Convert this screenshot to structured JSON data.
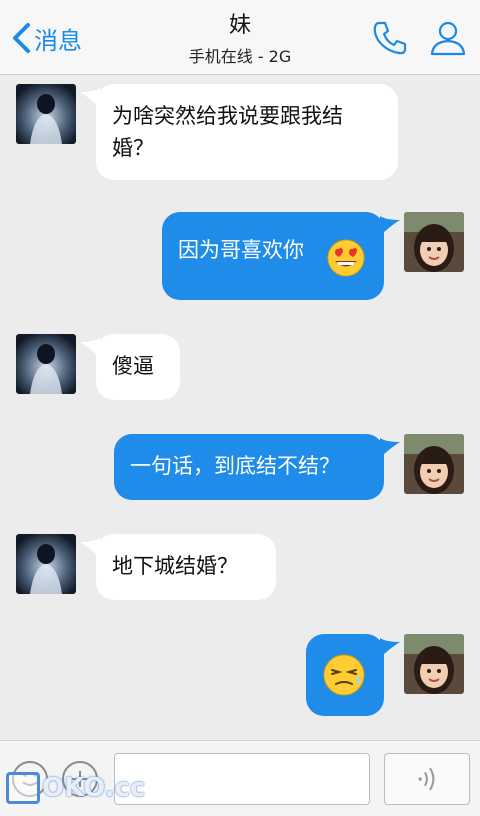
{
  "header": {
    "back_label": "消息",
    "title": "妹",
    "subtitle": "手机在线 - 2G"
  },
  "messages": [
    {
      "side": "left",
      "text": "为啥突然给我说要跟我结婚？"
    },
    {
      "side": "right",
      "text": "因为哥喜欢你",
      "emoji": "heart-eyes-emoji"
    },
    {
      "side": "left",
      "text": "傻逼"
    },
    {
      "side": "right",
      "text": "一句话，到底结不结？"
    },
    {
      "side": "left",
      "text": "地下城结婚？"
    },
    {
      "side": "right",
      "text": "",
      "emoji": "sweat-emoji"
    }
  ],
  "watermark": "OKO.cc",
  "colors": {
    "accent": "#1a8ae8",
    "bubble_right": "#1e8ce8",
    "bubble_left": "#ffffff",
    "background": "#ececec"
  }
}
